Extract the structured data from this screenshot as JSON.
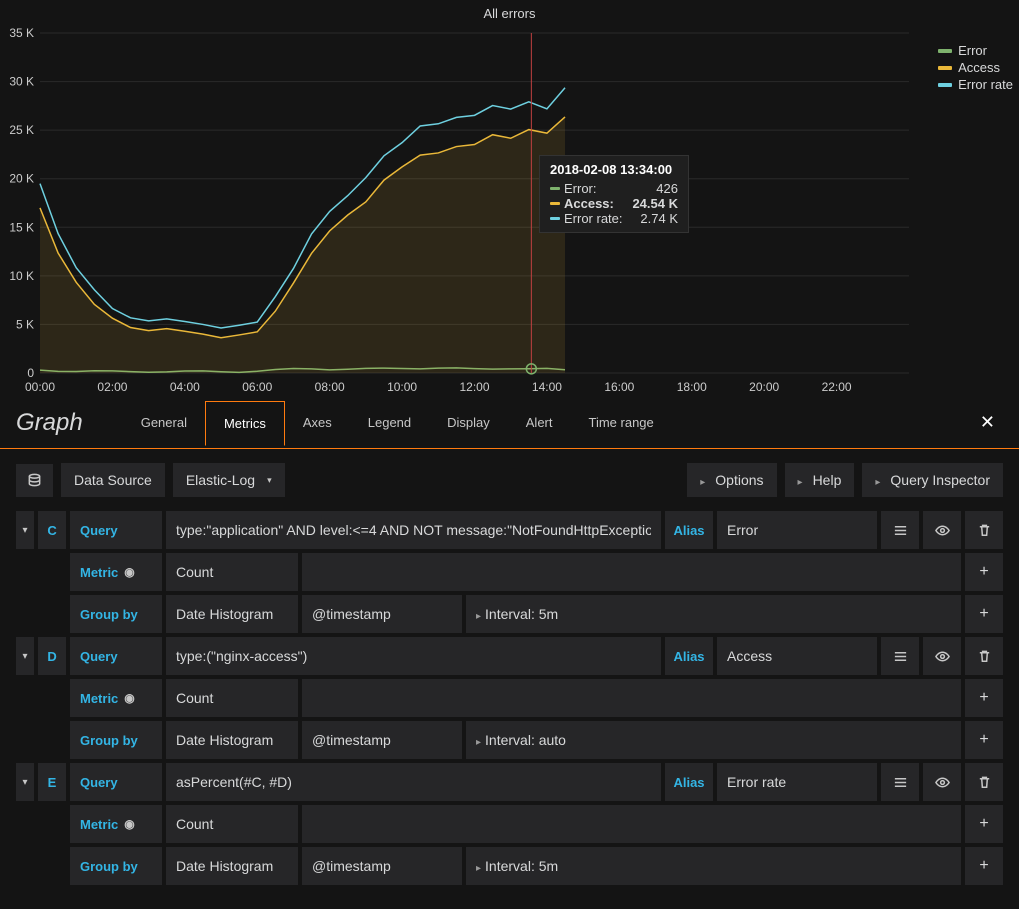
{
  "chart": {
    "title": "All errors",
    "legend": [
      {
        "name": "Error",
        "color": "#7eb26d"
      },
      {
        "name": "Access",
        "color": "#eab839"
      },
      {
        "name": "Error rate",
        "color": "#6ed0e0"
      }
    ],
    "tooltip": {
      "time": "2018-02-08 13:34:00",
      "rows": [
        {
          "name": "Error:",
          "value": "426",
          "color": "#7eb26d",
          "bold": false
        },
        {
          "name": "Access:",
          "value": "24.54 K",
          "color": "#eab839",
          "bold": true
        },
        {
          "name": "Error rate:",
          "value": "2.74 K",
          "color": "#6ed0e0",
          "bold": false
        }
      ]
    }
  },
  "chart_data": {
    "type": "line",
    "title": "All errors",
    "ylabel": "",
    "xlabel": "",
    "ylim": [
      0,
      35000
    ],
    "y_ticks": [
      "0",
      "5 K",
      "10 K",
      "15 K",
      "20 K",
      "25 K",
      "30 K",
      "35 K"
    ],
    "x_ticks": [
      "00:00",
      "02:00",
      "04:00",
      "06:00",
      "08:00",
      "10:00",
      "12:00",
      "14:00",
      "16:00",
      "18:00",
      "20:00",
      "22:00"
    ],
    "cursor_x": "13:34",
    "series": [
      {
        "name": "Error",
        "color": "#7eb26d",
        "x": [
          "00:00",
          "01:00",
          "02:00",
          "03:00",
          "04:00",
          "05:00",
          "06:00",
          "07:00",
          "08:00",
          "09:00",
          "10:00",
          "11:00",
          "12:00",
          "13:00",
          "13:34",
          "14:00",
          "14:30"
        ],
        "values": [
          300,
          200,
          150,
          150,
          150,
          150,
          200,
          400,
          400,
          400,
          500,
          500,
          400,
          500,
          426,
          400,
          300
        ]
      },
      {
        "name": "Access",
        "color": "#eab839",
        "x": [
          "00:00",
          "01:00",
          "02:00",
          "03:00",
          "04:00",
          "05:00",
          "06:00",
          "07:00",
          "08:00",
          "09:00",
          "10:00",
          "11:00",
          "12:00",
          "13:00",
          "13:34",
          "14:00",
          "14:30"
        ],
        "values": [
          17000,
          9000,
          6000,
          4500,
          4000,
          4000,
          4500,
          9000,
          15000,
          18000,
          21000,
          23000,
          24000,
          24000,
          24540,
          25000,
          26500
        ]
      },
      {
        "name": "Error rate",
        "color": "#6ed0e0",
        "x": [
          "00:00",
          "01:00",
          "02:00",
          "03:00",
          "04:00",
          "05:00",
          "06:00",
          "07:00",
          "08:00",
          "09:00",
          "10:00",
          "11:00",
          "12:00",
          "13:00",
          "13:34",
          "14:00",
          "14:30"
        ],
        "values": [
          19500,
          10500,
          7000,
          5500,
          5000,
          5000,
          5500,
          10500,
          17000,
          20500,
          23500,
          26000,
          27000,
          27000,
          2740,
          27500,
          29500
        ]
      }
    ],
    "render_series": [
      {
        "name": "Error",
        "color": "#7eb26d",
        "fill": false,
        "values": [
          300,
          250,
          200,
          180,
          150,
          150,
          150,
          150,
          150,
          150,
          150,
          150,
          200,
          300,
          400,
          450,
          400,
          400,
          400,
          450,
          500,
          500,
          500,
          450,
          400,
          450,
          500,
          426,
          400,
          300
        ]
      },
      {
        "name": "Access",
        "color": "#eab839",
        "fill": true,
        "values": [
          17000,
          12000,
          9000,
          7000,
          6000,
          5000,
          4500,
          4200,
          4000,
          3800,
          4000,
          4200,
          4500,
          6000,
          9000,
          12000,
          15000,
          16500,
          18000,
          19500,
          21000,
          22000,
          23000,
          23500,
          24000,
          24200,
          24000,
          24540,
          25000,
          26500
        ]
      },
      {
        "name": "Error rate",
        "color": "#6ed0e0",
        "fill": false,
        "values": [
          19500,
          14000,
          10500,
          8500,
          7000,
          6000,
          5500,
          5200,
          5000,
          4800,
          5000,
          5200,
          5500,
          7500,
          10500,
          14000,
          17000,
          18500,
          20500,
          22000,
          23500,
          25000,
          26000,
          26500,
          27000,
          27200,
          27000,
          27400,
          27500,
          29500
        ]
      }
    ]
  },
  "editor": {
    "title": "Graph",
    "tabs": [
      "General",
      "Metrics",
      "Axes",
      "Legend",
      "Display",
      "Alert",
      "Time range"
    ],
    "active_tab": "Metrics",
    "toolbar": {
      "datasource_label": "Data Source",
      "datasource_value": "Elastic-Log",
      "options": "Options",
      "help": "Help",
      "inspector": "Query Inspector"
    },
    "queries": [
      {
        "id": "C",
        "query": "type:\"application\" AND level:<=4 AND NOT message:\"NotFoundHttpExceptio...",
        "alias_label": "Alias",
        "alias": "Error",
        "metric": "Count",
        "groupby": "Date Histogram",
        "field": "@timestamp",
        "interval": "Interval: 5m"
      },
      {
        "id": "D",
        "query": "type:(\"nginx-access\")",
        "alias_label": "Alias",
        "alias": "Access",
        "metric": "Count",
        "groupby": "Date Histogram",
        "field": "@timestamp",
        "interval": "Interval: auto"
      },
      {
        "id": "E",
        "query": "asPercent(#C, #D)",
        "alias_label": "Alias",
        "alias": "Error rate",
        "metric": "Count",
        "groupby": "Date Histogram",
        "field": "@timestamp",
        "interval": "Interval: 5m"
      }
    ],
    "labels": {
      "query": "Query",
      "metric": "Metric",
      "groupby": "Group by"
    }
  }
}
